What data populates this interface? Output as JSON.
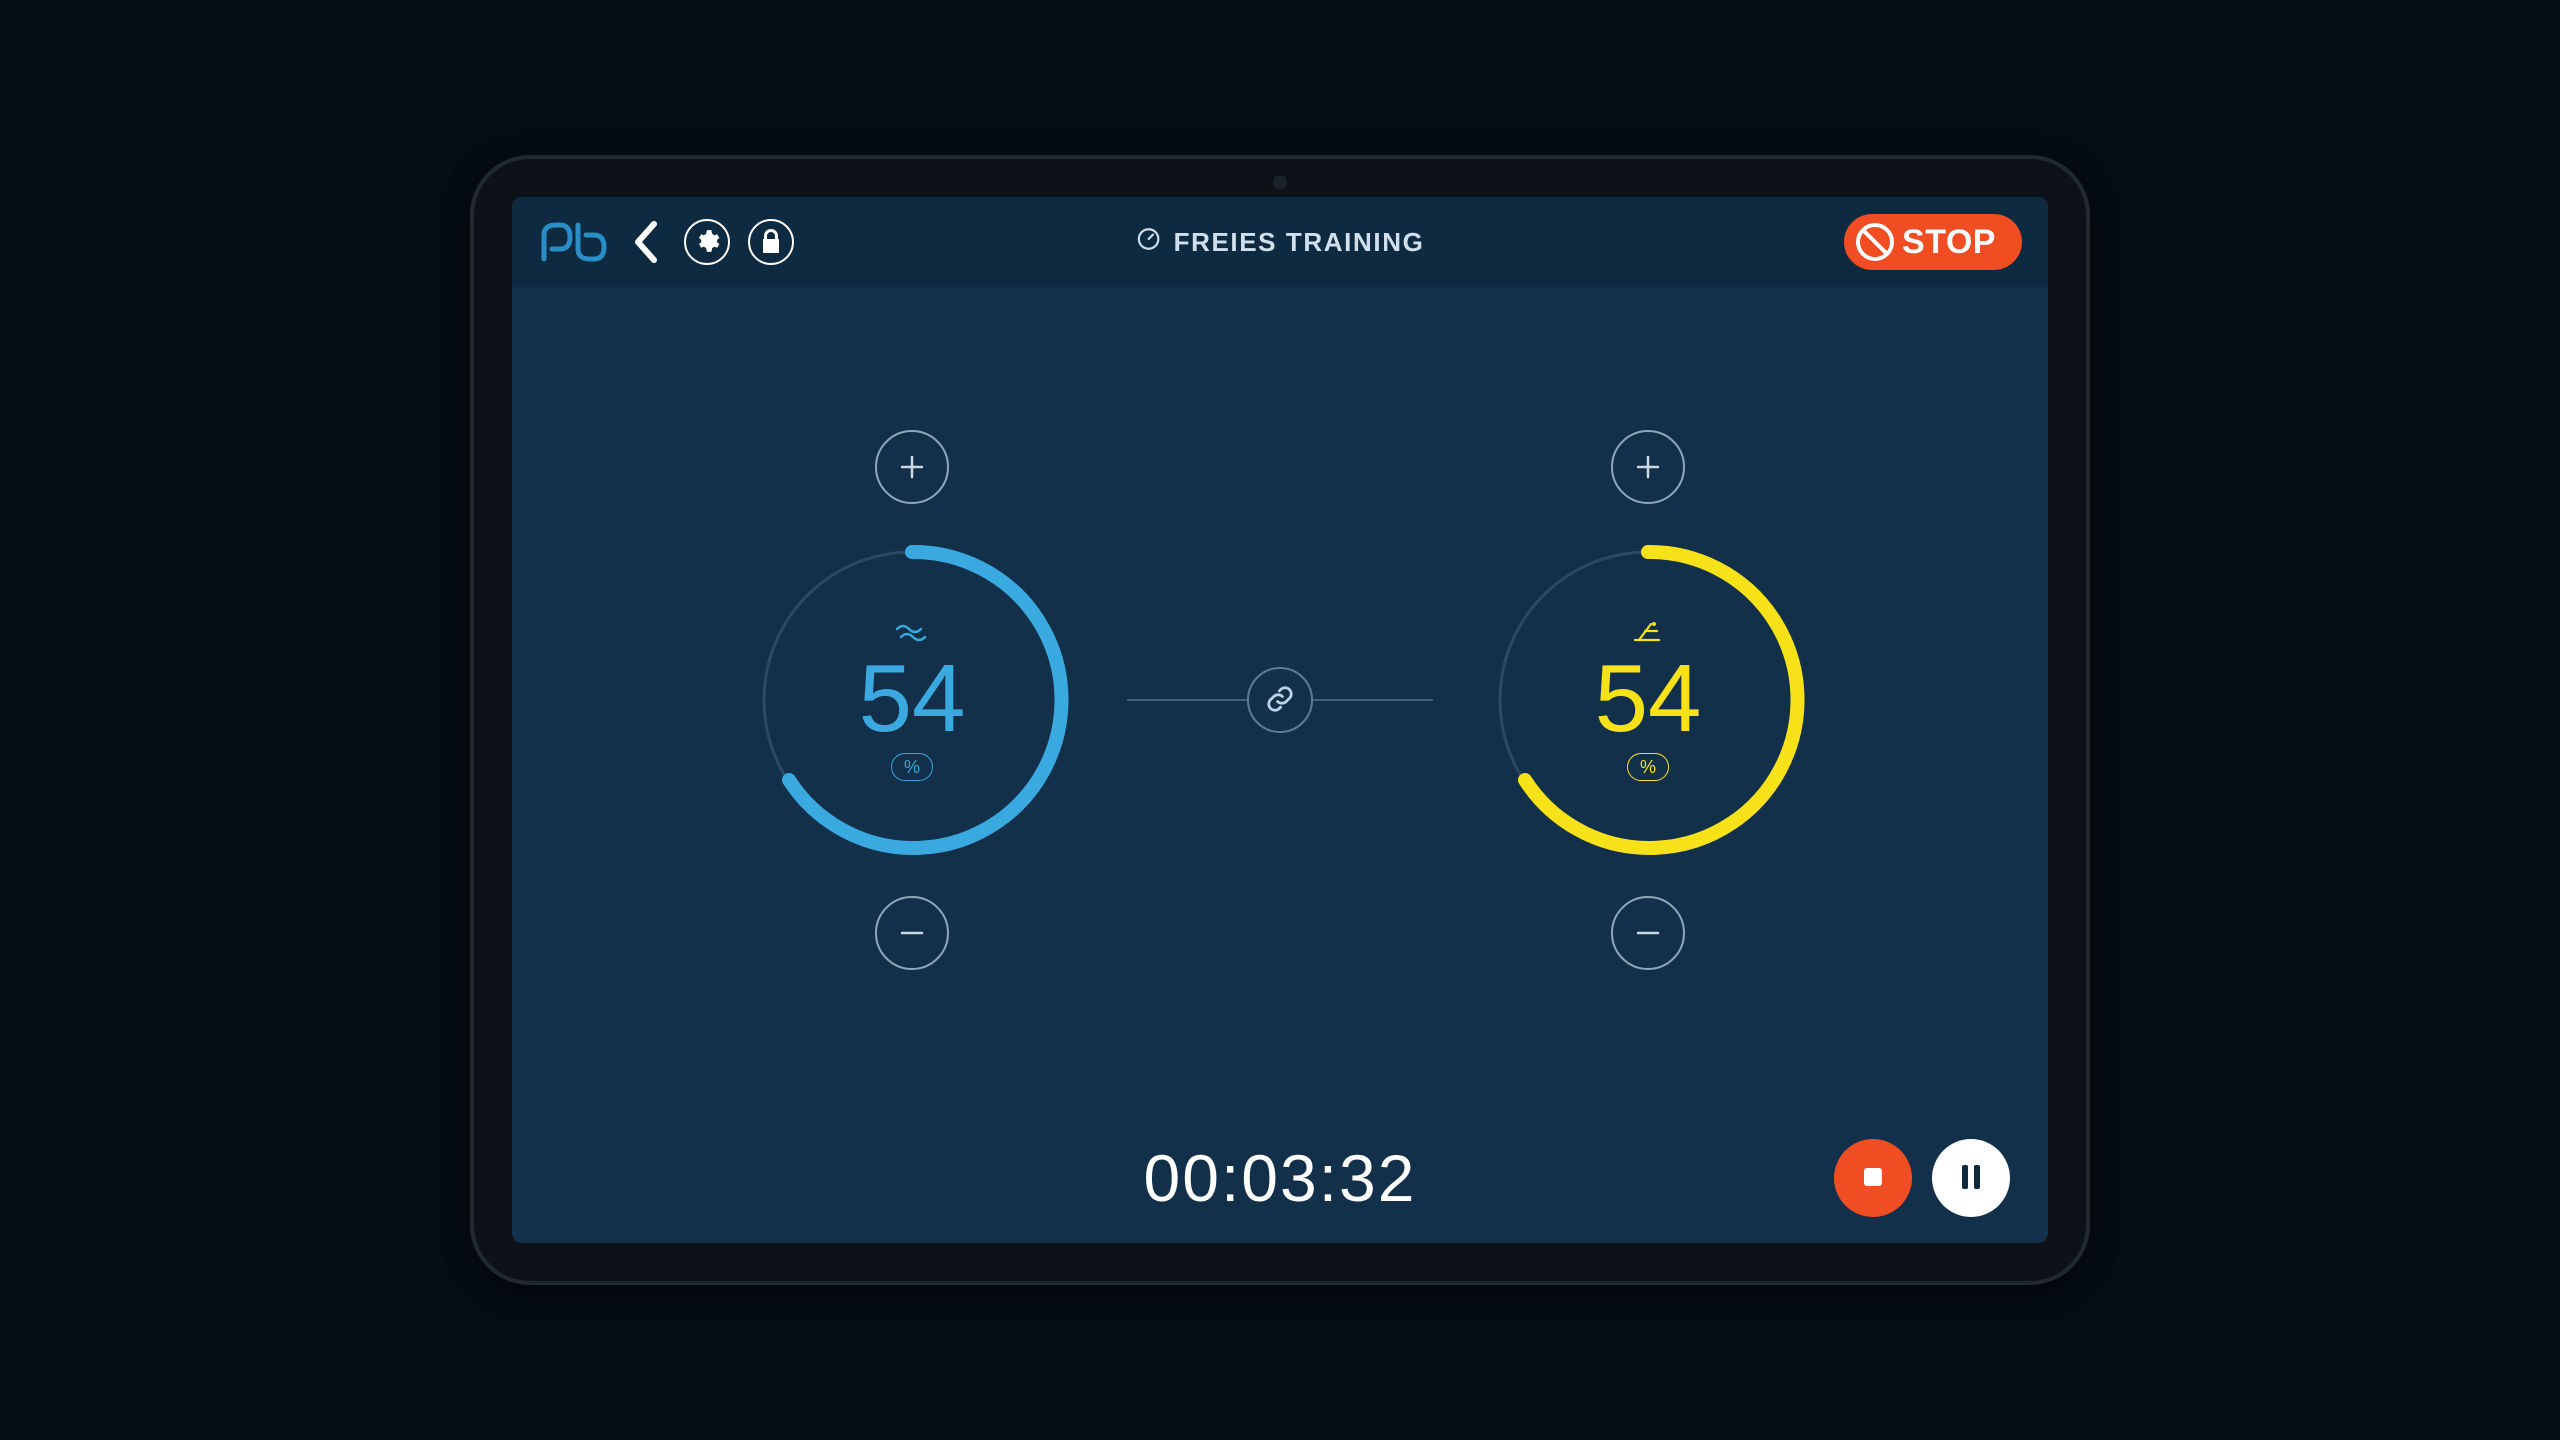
{
  "header": {
    "title": "FREIES TRAINING",
    "stop_label": "STOP"
  },
  "gauges": {
    "left": {
      "value": "54",
      "unit": "%",
      "percent": 54,
      "color": "#39a9e0"
    },
    "right": {
      "value": "54",
      "unit": "%",
      "percent": 54,
      "color": "#f7e21a"
    }
  },
  "timer": "00:03:32",
  "colors": {
    "accent_orange": "#f04d23",
    "bg": "#123049"
  }
}
